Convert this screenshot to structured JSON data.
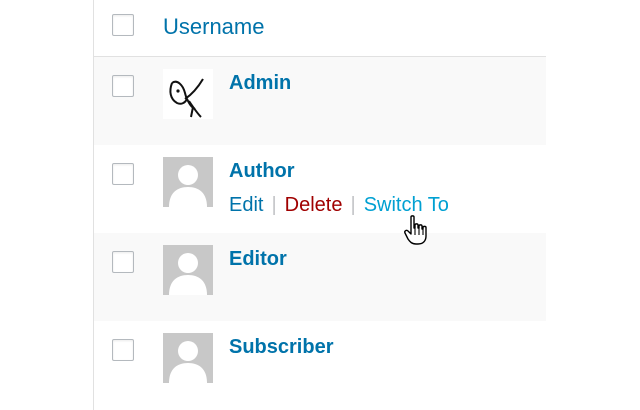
{
  "table": {
    "header": {
      "username_label": "Username"
    },
    "rows": [
      {
        "username": "Admin",
        "avatar": "custom-drawing-avatar"
      },
      {
        "username": "Author",
        "avatar": "default-person-avatar",
        "actions": {
          "edit": "Edit",
          "delete": "Delete",
          "switch": "Switch To"
        }
      },
      {
        "username": "Editor",
        "avatar": "default-person-avatar"
      },
      {
        "username": "Subscriber",
        "avatar": "default-person-avatar"
      }
    ]
  },
  "colors": {
    "link": "#0073aa",
    "delete": "#a00000",
    "hover_link": "#00a0d2",
    "alt_row": "#f9f9f9"
  },
  "cursor": "hand-pointer-icon"
}
